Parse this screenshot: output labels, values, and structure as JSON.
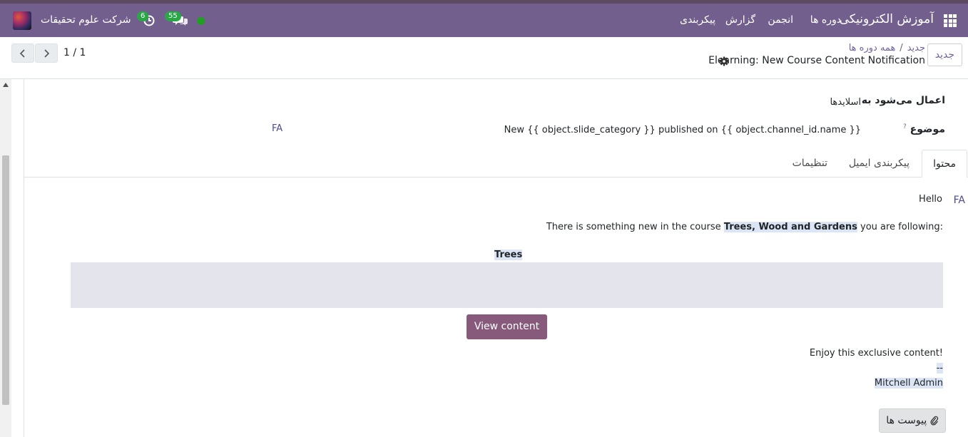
{
  "navbar": {
    "brand": "آموزش الکترونیکی",
    "menu": [
      "دوره ها",
      "انجمن",
      "گزارش",
      "پیکربندی"
    ],
    "chat_count": "55",
    "activity_count": "6",
    "company": "شرکت علوم تحقیقات",
    "color": "#735f8e"
  },
  "control_panel": {
    "new_button": "جدید",
    "breadcrumb_parent": "همه دوره ها",
    "breadcrumb_separator": "/",
    "breadcrumb_current": "جدید",
    "record_title": "Elearning: New Course Content Notification",
    "pager": "1 / 1"
  },
  "form": {
    "applies_to_label": "اعمال می‌شود به",
    "applies_to_value": "اسلایدها",
    "subject_label": "موضوع",
    "subject_help": "?",
    "subject_value": "New {{ object.slide_category }} published on {{ object.channel_id.name }}",
    "subject_lang": "FA"
  },
  "tabs": [
    "محتوا",
    "پیکربندی ایمیل",
    "تنظیمات"
  ],
  "body": {
    "lang": "FA",
    "hello": "Hello",
    "line_prefix": "There is something new in the course",
    "course_name": "Trees, Wood and Gardens",
    "line_suffix": "you are following:",
    "slide_name": "Trees",
    "view_button": "View content",
    "enjoy": "Enjoy this exclusive content!",
    "signature_sep": "--",
    "signature": "Mitchell Admin",
    "attachments_button": "پیوست ها",
    "button_color": "#875a7b"
  }
}
